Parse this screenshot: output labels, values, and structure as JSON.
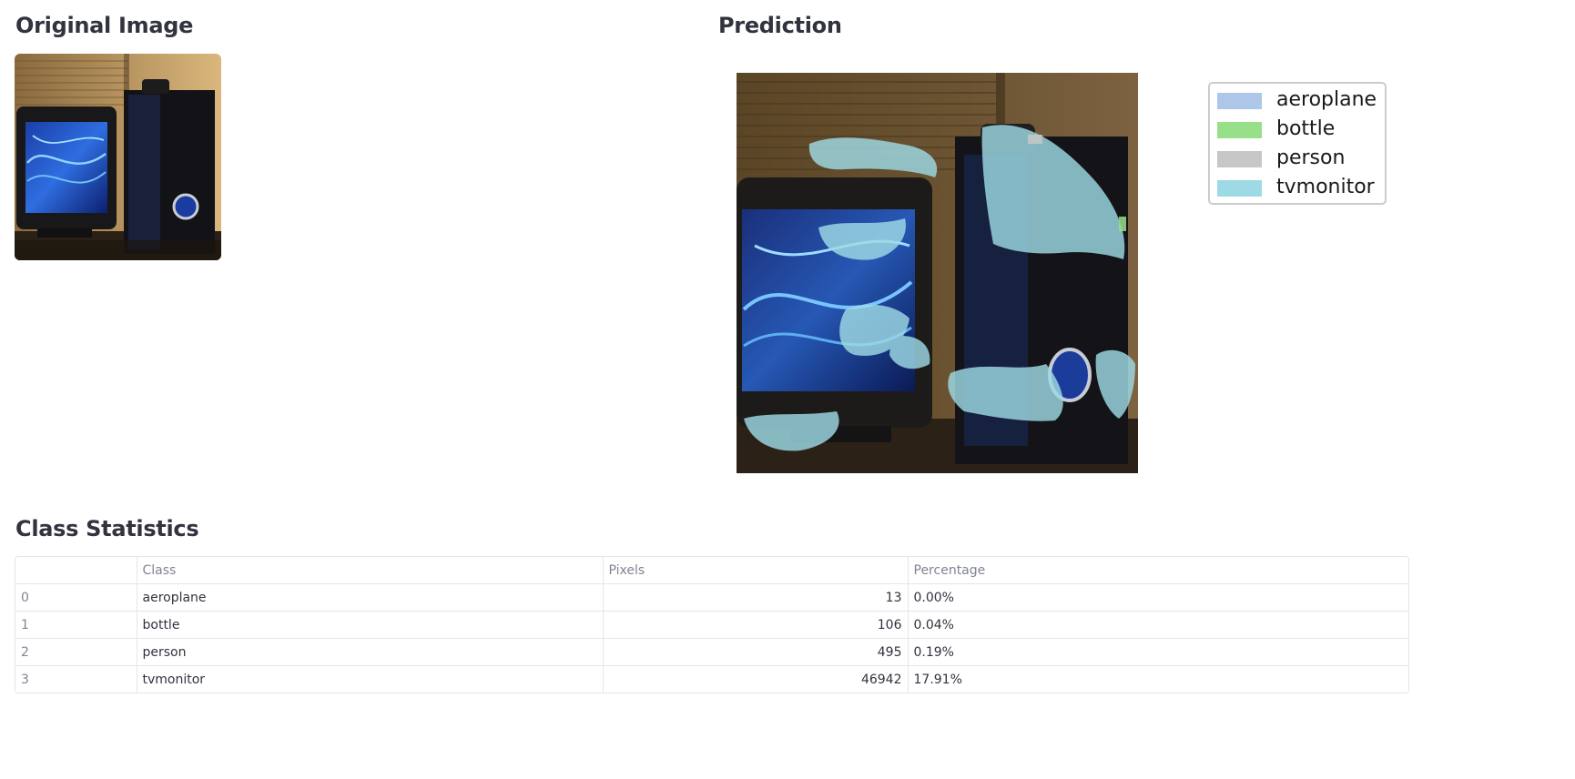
{
  "sections": {
    "original_title": "Original Image",
    "prediction_title": "Prediction",
    "stats_title": "Class Statistics"
  },
  "legend": [
    {
      "label": "aeroplane",
      "color": "#aec7e8"
    },
    {
      "label": "bottle",
      "color": "#98df8a"
    },
    {
      "label": "person",
      "color": "#c7c7c7"
    },
    {
      "label": "tvmonitor",
      "color": "#9edae5"
    }
  ],
  "table": {
    "columns": [
      "",
      "Class",
      "Pixels",
      "Percentage"
    ],
    "rows": [
      {
        "index": "0",
        "class": "aeroplane",
        "pixels": "13",
        "percentage": "0.00%"
      },
      {
        "index": "1",
        "class": "bottle",
        "pixels": "106",
        "percentage": "0.04%"
      },
      {
        "index": "2",
        "class": "person",
        "pixels": "495",
        "percentage": "0.19%"
      },
      {
        "index": "3",
        "class": "tvmonitor",
        "pixels": "46942",
        "percentage": "17.91%"
      }
    ]
  }
}
